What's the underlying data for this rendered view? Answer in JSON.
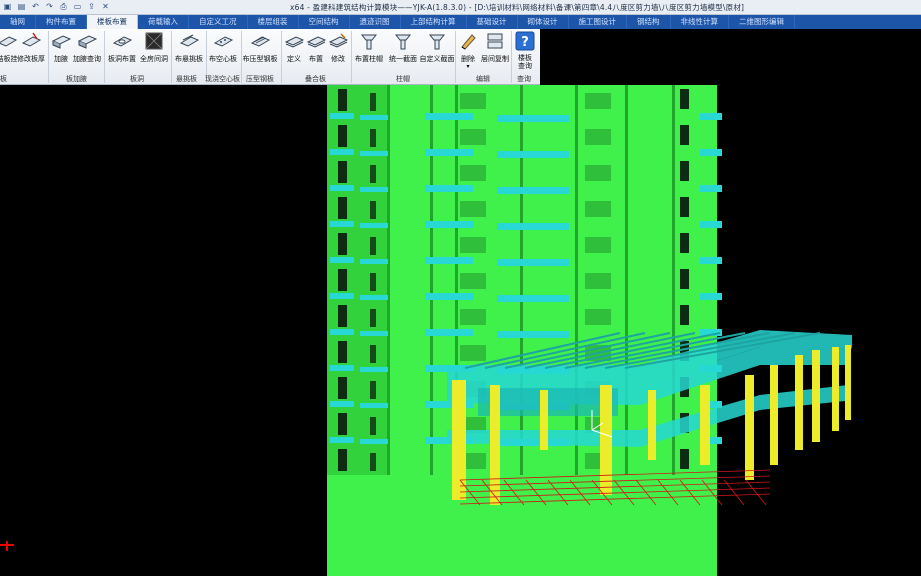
{
  "window": {
    "title": "x64 - 盈建科建筑结构计算模块——YJK-A(1.8.3.0) - [D:\\培训材料\\网络材料\\备课\\第四章\\4.4八度区剪力墙\\八度区剪力墙模型\\原材]"
  },
  "tabs": [
    "轴网",
    "构件布置",
    "楼板布置",
    "荷载输入",
    "自定义工况",
    "楼层组装",
    "空间结构",
    "遗迹识图",
    "上部结构计算",
    "基础设计",
    "砌体设计",
    "施工图设计",
    "钢结构",
    "非线性计算",
    "二维图形编辑"
  ],
  "active_tab_index": 2,
  "ribbon": {
    "buttons": [
      {
        "key": "b0",
        "label": "结板挂"
      },
      {
        "key": "b1",
        "label": "修改板厚"
      },
      {
        "key": "b2",
        "label": "加腋"
      },
      {
        "key": "b3",
        "label": "加腋查询"
      },
      {
        "key": "b4",
        "label": "板洞布置"
      },
      {
        "key": "b5",
        "label": "全房间洞"
      },
      {
        "key": "b6",
        "label": "布悬挑板"
      },
      {
        "key": "b7",
        "label": "布空心板"
      },
      {
        "key": "b8",
        "label": "布压型钢板"
      },
      {
        "key": "b9",
        "label": "定义"
      },
      {
        "key": "b10",
        "label": "布置"
      },
      {
        "key": "b11",
        "label": "修改"
      },
      {
        "key": "b12",
        "label": "布置柱帽"
      },
      {
        "key": "b13",
        "label": "统一截面"
      },
      {
        "key": "b14",
        "label": "自定义截面"
      },
      {
        "key": "b15",
        "label": "删除"
      },
      {
        "key": "b16",
        "label": "层间复制"
      },
      {
        "key": "b17",
        "label": "楼板\n查询"
      }
    ],
    "groups": [
      "板",
      "板加腋",
      "板洞",
      "悬挑板",
      "现浇空心板",
      "压型钢板",
      "叠合板",
      "柱帽",
      "编辑",
      "查询"
    ]
  },
  "icons": {
    "qat": [
      "save-icon",
      "new-icon",
      "undo-icon",
      "redo-icon",
      "print-icon",
      "open-icon",
      "export-icon",
      "close-icon"
    ],
    "help": "question-icon"
  },
  "colors": {
    "wall": "#3ff14a",
    "slab": "#27d8d4",
    "column": "#ecec2a",
    "red_lines": "#d01818",
    "tab_bar": "#1d55a8"
  },
  "model": {
    "description_visible": false,
    "floors_tower": 13,
    "floors_podium": 3
  }
}
